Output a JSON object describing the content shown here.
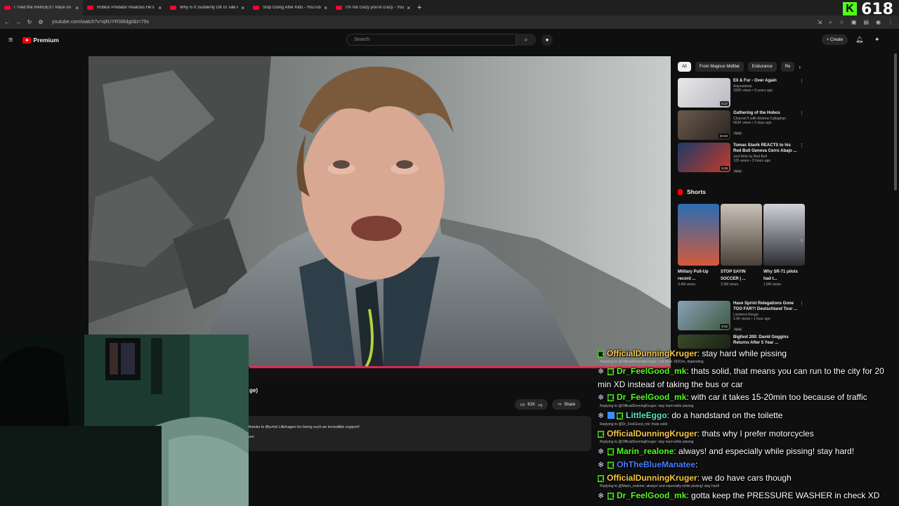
{
  "browser": {
    "tabs": [
      {
        "title": "I Tried the HARDEST Race on th"
      },
      {
        "title": "Roblox Predator Realizes He's B"
      },
      {
        "title": "Why Is It Suddenly OK to Talk A"
      },
      {
        "title": "Stop Going After Kids - YouTub"
      },
      {
        "title": "I'm not crazy you're crazy - You"
      }
    ],
    "new_tab": "+",
    "close": "×",
    "url": "youtube.com/watch?v=q9UYRS6ldg0&t=79s"
  },
  "kick_overlay": {
    "logo": "K",
    "viewers": "618"
  },
  "youtube": {
    "brand": "Premium",
    "search_placeholder": "Search",
    "create_label": "+ Create",
    "video": {
      "title_fragment": "ge)",
      "likes": "81K",
      "share_label": "Share",
      "description": "thanks to Øyvind Lillehagen for being such an incredible support!",
      "more": "ore"
    },
    "chips": [
      "All",
      "From Magnus Midtbø",
      "Endurance",
      "Re"
    ],
    "colors": {
      "progress": "#ff2a55",
      "brand_red": "#ff0000"
    },
    "recommendations": [
      {
        "title": "Eli & Fur - Over Again",
        "channel": "Anjunadeep",
        "meta": "150K views • 9 years ago",
        "duration": "5:17",
        "badge": ""
      },
      {
        "title": "Gathering of the Hobos",
        "channel": "Channel 5 with Andrew Callaghan",
        "meta": "663K views • 2 days ago",
        "duration": "25:53",
        "badge": "New"
      },
      {
        "title": "Tomas Slavik REACTS to his Red Bull Genova Cerro Abajo ...",
        "channel": "Just Ride by Red Bull",
        "meta": "125 views • 3 hours ago",
        "duration": "5:29",
        "badge": "New"
      }
    ],
    "shorts_header": "Shorts",
    "shorts": [
      {
        "title": "Military Pull-Up record ...",
        "views": "3.4M views"
      },
      {
        "title": "STOP SAYIN SOCCER | ...",
        "views": "2.9M views"
      },
      {
        "title": "Why SR-71 pilots had t...",
        "views": "1.8M views"
      }
    ],
    "recommendations_2": [
      {
        "title": "Have Sprint Relegations Gone TOO FAR?! Deutschland Tour ...",
        "channel": "Lanterne Rouge",
        "meta": "2.6K views • 1 hour ago",
        "duration": "8:02",
        "badge": "New"
      },
      {
        "title": "Bigfoot 200: David Goggins Returns After 5 Year ...",
        "channel": "",
        "meta": "",
        "duration": "",
        "badge": ""
      }
    ]
  },
  "chat": [
    {
      "user": "OfficialDunningKruger",
      "color": "gold",
      "badges": [
        "kick"
      ],
      "reply": "",
      "text": ": stay hard while pissing"
    },
    {
      "user": "Dr_FeelGood_mk",
      "color": "green",
      "badges": [
        "snow",
        "kick"
      ],
      "reply": "Replying to @OfficialDunningKruger: I do 5k in 19/21m, depending",
      "text": ": thats solid, that means you can run to the city for 20 min XD instead of taking the bus or car"
    },
    {
      "user": "Dr_FeelGood_mk",
      "color": "green",
      "badges": [
        "snow",
        "kick"
      ],
      "reply": "Replying to @OfficialDunningKruger: stay hard while pissing",
      "text": ": with car it takes 15-20min too because of traffic"
    },
    {
      "user": "LittleEggo",
      "color": "teal",
      "badges": [
        "snow",
        "cube",
        "kick"
      ],
      "reply": "Replying to @Dr_FeelGood_mk: thats solid",
      "text": ": do a handstand on the toilette"
    },
    {
      "user": "OfficialDunningKruger",
      "color": "gold",
      "badges": [
        "kick"
      ],
      "reply": "Replying to @OfficialDunningKruger: stay hard while pissing",
      "text": ": thats why I prefer motorcycles"
    },
    {
      "user": "Marin_realone",
      "color": "green",
      "badges": [
        "snow",
        "kick"
      ],
      "reply": "",
      "text": ": always! and especially while pissing! stay hard!"
    },
    {
      "user": "OhTheBlueManatee",
      "color": "blue",
      "badges": [
        "snow",
        "kick"
      ],
      "reply": "",
      "text": ":"
    },
    {
      "user": "OfficialDunningKruger",
      "color": "gold",
      "badges": [
        "kick"
      ],
      "reply": "Replying to @Marin_realone: always! and especially while pissing! stay hard!",
      "text": ": we do have cars though"
    },
    {
      "user": "Dr_FeelGood_mk",
      "color": "green",
      "badges": [
        "snow",
        "kick"
      ],
      "reply": "",
      "text": ": gotta keep the PRESSURE WASHER in check XD"
    }
  ]
}
